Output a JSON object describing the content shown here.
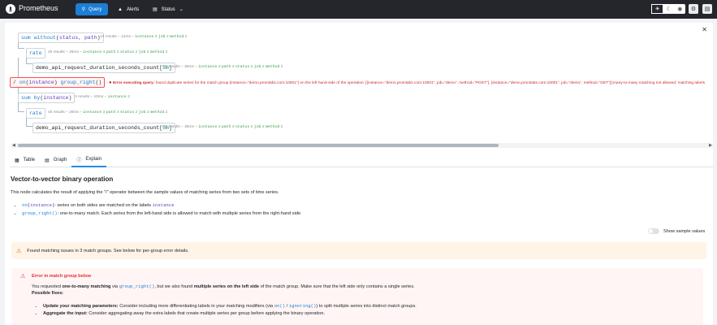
{
  "header": {
    "app_title": "Prometheus",
    "nav": {
      "query": "Query",
      "alerts": "Alerts",
      "status": "Status"
    }
  },
  "tree": {
    "nodes": {
      "n1": {
        "fn": "sum",
        "kw": "without",
        "labels": "status, path"
      },
      "n2": {
        "fn": "rate"
      },
      "n3": {
        "metric": "demo_api_request_duration_seconds_count",
        "range": "5m"
      },
      "n4": {
        "op": "/",
        "mod1": "on",
        "lbl1": "instance",
        "mod2": "group_right",
        "lbl2": ""
      },
      "n5": {
        "fn": "sum",
        "kw": "by",
        "labels": "instance"
      },
      "n6": {
        "fn": "rate"
      },
      "n7": {
        "metric": "demo_api_request_duration_seconds_count",
        "range": "5m"
      }
    },
    "meta": {
      "m1": {
        "count": "10 results",
        "time": "12ms",
        "labels": [
          [
            "instance",
            "3"
          ],
          [
            "job",
            "2"
          ],
          [
            "method",
            "2"
          ]
        ]
      },
      "m2": {
        "count": "45 results",
        "time": "28ms",
        "labels": [
          [
            "instance",
            "3"
          ],
          [
            "path",
            "3"
          ],
          [
            "status",
            "2"
          ],
          [
            "job",
            "2"
          ],
          [
            "method",
            "2"
          ]
        ]
      },
      "m3": {
        "count": "45 results",
        "time": "36ms",
        "labels": [
          [
            "instance",
            "3"
          ],
          [
            "path",
            "3"
          ],
          [
            "status",
            "2"
          ],
          [
            "job",
            "2"
          ],
          [
            "method",
            "2"
          ]
        ]
      },
      "m5": {
        "count": "3 results",
        "time": "10ms",
        "labels": [
          [
            "instance",
            "3"
          ]
        ]
      },
      "m6": {
        "count": "45 results",
        "time": "28ms",
        "labels": [
          [
            "instance",
            "3"
          ],
          [
            "path",
            "3"
          ],
          [
            "status",
            "2"
          ],
          [
            "job",
            "2"
          ],
          [
            "method",
            "2"
          ]
        ]
      },
      "m7": {
        "count": "45 results",
        "time": "36ms",
        "labels": [
          [
            "instance",
            "3"
          ],
          [
            "path",
            "3"
          ],
          [
            "status",
            "2"
          ],
          [
            "job",
            "2"
          ],
          [
            "method",
            "2"
          ]
        ]
      }
    },
    "error": {
      "prefix": "Error executing query:",
      "text": "found duplicate series for the match group {instance=\"demo.promlabs.com:10001\"} on the left hand-side of the operation: [{instance=\"demo.promlabs.com:10001\", job=\"demo\", method=\"POST\"}, {instance=\"demo.promlabs.com:10001\", job=\"demo\", method=\"GET\"}];many-to-many matching not allowed: matching labels"
    }
  },
  "tabs": {
    "table": "Table",
    "graph": "Graph",
    "explain": "Explain"
  },
  "explain": {
    "title": "Vector-to-vector binary operation",
    "desc_a": "This node calculates the result of applying the \"",
    "desc_op": "/",
    "desc_b": "\" operator between the sample values of matching series from two sets of time series.",
    "b1_code_fn": "on",
    "b1_code_lbl": "instance",
    "b1_text_a": ": series on both sides are matched on the labels ",
    "b1_code_lbl2": "instance",
    "b2_code": "group_right()",
    "b2_text": ": one-to-many match. Each series from the left-hand side is allowed to match with multiple series from the right-hand side.",
    "toggle_label": "Show sample values",
    "warning": "Found matching issues in 3 match groups. See below for per-group error details.",
    "err_title": "Error in match group below",
    "err_a": "You requested ",
    "err_b": "one-to-many matching",
    "err_c": " via ",
    "err_code": "group_right()",
    "err_d": ", but we also found ",
    "err_e": "multiple series on the left side",
    "err_f": " of the match group. Make sure that the left side only contains a single series.",
    "possible": "Possible fixes:",
    "fix1_b": "Update your matching parameters:",
    "fix1_a": " Consider including more differentiating labels in your matching modifiers (via ",
    "fix1_c1": "on()",
    "fix1_sep": " / ",
    "fix1_c2": "ignoring()",
    "fix1_z": ") to split multiple series into distinct match groups.",
    "fix2_b": "Aggregate the input:",
    "fix2_a": " Consider aggregating away the extra labels that create multiple series per group before applying the binary operation."
  },
  "colors": {
    "accent": "#1c7ed6",
    "header": "#25262b",
    "error": "#e03131",
    "warning_bg": "#fff4e6"
  }
}
